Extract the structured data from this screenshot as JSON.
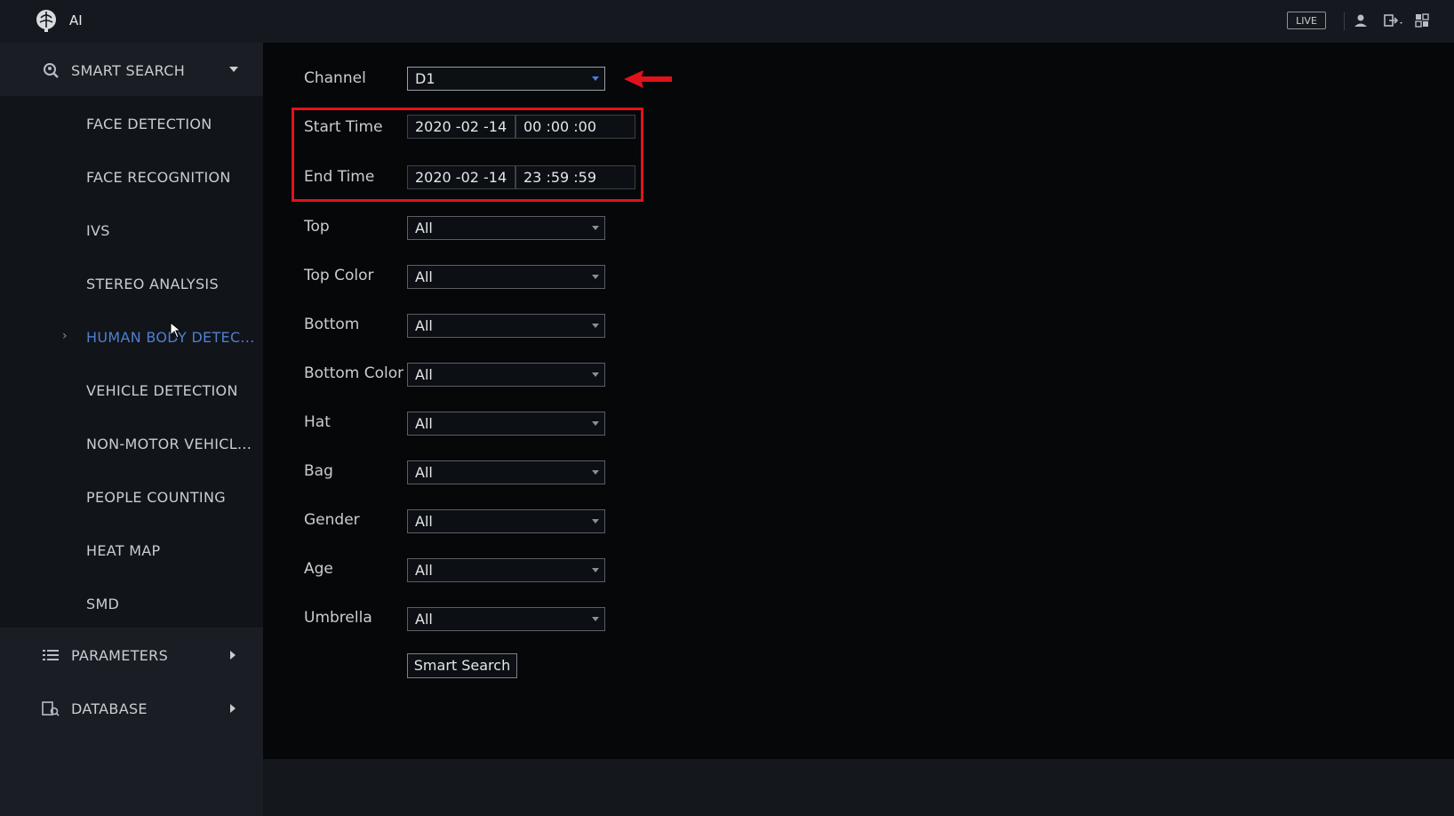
{
  "app": {
    "title": "AI"
  },
  "topbar": {
    "live_label": "LIVE",
    "icons": [
      "user-icon",
      "logout-icon",
      "layout-icon"
    ]
  },
  "sidebar": {
    "smart_search": {
      "label": "SMART SEARCH",
      "icon": "smart-search-icon"
    },
    "items": [
      {
        "label": "FACE DETECTION"
      },
      {
        "label": "FACE RECOGNITION"
      },
      {
        "label": "IVS"
      },
      {
        "label": "STEREO ANALYSIS"
      },
      {
        "label": "HUMAN BODY DETEC..."
      },
      {
        "label": "VEHICLE DETECTION"
      },
      {
        "label": "NON-MOTOR VEHICL..."
      },
      {
        "label": "PEOPLE COUNTING"
      },
      {
        "label": "HEAT MAP"
      },
      {
        "label": "SMD"
      }
    ],
    "active_index": 4,
    "parameters": {
      "label": "PARAMETERS",
      "icon": "list-icon"
    },
    "database": {
      "label": "DATABASE",
      "icon": "database-icon"
    }
  },
  "form": {
    "channel": {
      "label": "Channel",
      "value": "D1"
    },
    "start_time": {
      "label": "Start Time",
      "date": "2020 -02 -14",
      "time": "00 :00 :00"
    },
    "end_time": {
      "label": "End Time",
      "date": "2020 -02 -14",
      "time": "23 :59 :59"
    },
    "top": {
      "label": "Top",
      "value": "All"
    },
    "top_color": {
      "label": "Top Color",
      "value": "All"
    },
    "bottom": {
      "label": "Bottom",
      "value": "All"
    },
    "bottom_color": {
      "label": "Bottom Color",
      "value": "All"
    },
    "hat": {
      "label": "Hat",
      "value": "All"
    },
    "bag": {
      "label": "Bag",
      "value": "All"
    },
    "gender": {
      "label": "Gender",
      "value": "All"
    },
    "age": {
      "label": "Age",
      "value": "All"
    },
    "umbrella": {
      "label": "Umbrella",
      "value": "All"
    },
    "search_button": "Smart Search"
  },
  "colors": {
    "accent": "#4f7fd1",
    "highlight": "#e0121b",
    "background": "#050709",
    "sidebar": "#1a1e24"
  }
}
